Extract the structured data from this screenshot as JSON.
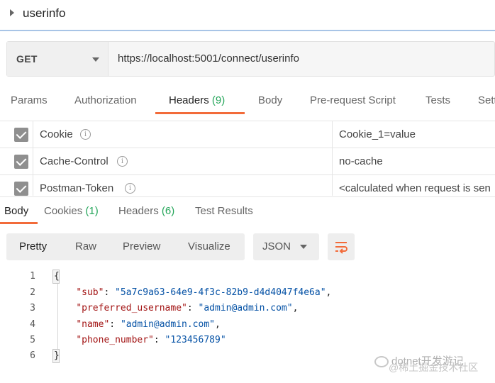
{
  "request": {
    "name": "userinfo",
    "method": "GET",
    "url": "https://localhost:5001/connect/userinfo"
  },
  "request_tabs": [
    {
      "label": "Params",
      "count": ""
    },
    {
      "label": "Authorization",
      "count": ""
    },
    {
      "label": "Headers",
      "count": "(9)"
    },
    {
      "label": "Body",
      "count": ""
    },
    {
      "label": "Pre-request Script",
      "count": ""
    },
    {
      "label": "Tests",
      "count": ""
    },
    {
      "label": "Sett",
      "count": ""
    }
  ],
  "active_request_tab": "Headers",
  "headers": [
    {
      "key": "Cookie",
      "value": "Cookie_1=value",
      "checked": true
    },
    {
      "key": "Cache-Control",
      "value": "no-cache",
      "checked": true
    },
    {
      "key": "Postman-Token",
      "value": "<calculated when request is sen",
      "checked": true
    }
  ],
  "response_tabs": [
    {
      "label": "Body",
      "count": ""
    },
    {
      "label": "Cookies",
      "count": "(1)"
    },
    {
      "label": "Headers",
      "count": "(6)"
    },
    {
      "label": "Test Results",
      "count": ""
    }
  ],
  "active_response_tab": "Body",
  "view_modes": [
    "Pretty",
    "Raw",
    "Preview",
    "Visualize"
  ],
  "active_view_mode": "Pretty",
  "format": "JSON",
  "code_lines": [
    {
      "n": "1",
      "key": "",
      "value": "",
      "text": "{"
    },
    {
      "n": "2",
      "key": "\"sub\"",
      "value": "\"5a7c9a63-64e9-4f3c-82b9-d4d4047f4e6a\"",
      "text": ""
    },
    {
      "n": "3",
      "key": "\"preferred_username\"",
      "value": "\"admin@admin.com\"",
      "text": ""
    },
    {
      "n": "4",
      "key": "\"name\"",
      "value": "\"admin@admin.com\"",
      "text": ""
    },
    {
      "n": "5",
      "key": "\"phone_number\"",
      "value": "\"123456789\"",
      "text": ""
    },
    {
      "n": "6",
      "key": "",
      "value": "",
      "text": "}"
    }
  ],
  "watermark": {
    "line1": "dotnet开发游记",
    "line2": "@稀土掘金技术社区"
  },
  "colors": {
    "accent": "#f26b3a",
    "count_green": "#26a65b",
    "json_key": "#a31515",
    "json_string": "#0451a5"
  }
}
